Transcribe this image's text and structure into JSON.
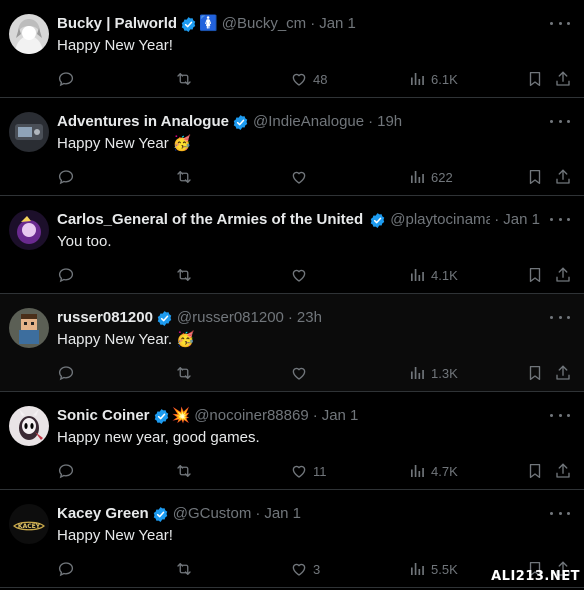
{
  "tweets": [
    {
      "name": "Bucky | Palworld",
      "verified": true,
      "badge_emoji": "🚺",
      "handle": "@Bucky_cm",
      "time": "Jan 1",
      "text": "Happy New Year!",
      "likes": "48",
      "views": "6.1K",
      "avatar": "white-haired-character-avatar"
    },
    {
      "name": "Adventures in Analogue",
      "verified": true,
      "handle": "@IndieAnalogue",
      "time": "19h",
      "text": "Happy New Year 🥳",
      "likes": "",
      "views": "622",
      "avatar": "dark-game-console-avatar"
    },
    {
      "name": "Carlos_General of the Armies of the United S",
      "verified": true,
      "handle": "@playtocinama",
      "time": "Jan 1",
      "text": "You too.",
      "likes": "",
      "views": "4.1K",
      "avatar": "purple-character-avatar"
    },
    {
      "name": "russer081200",
      "verified": true,
      "handle": "@russer081200",
      "time": "23h",
      "text": "Happy New Year. 🥳",
      "likes": "",
      "views": "1.3K",
      "avatar": "pixel-character-avatar"
    },
    {
      "name": "Sonic Coiner",
      "verified": true,
      "badge_emoji": "💥",
      "handle": "@nocoiner88869",
      "time": "Jan 1",
      "text": "Happy new year, good games.",
      "likes": "11",
      "views": "4.7K",
      "avatar": "masked-knight-avatar"
    },
    {
      "name": "Kacey Green",
      "verified": true,
      "handle": "@GCustom",
      "time": "Jan 1",
      "text": "Happy New Year!",
      "likes": "3",
      "views": "5.5K",
      "avatar": "kacey-logo-avatar"
    }
  ],
  "colors": {
    "background": "#000000",
    "text": "#e7e9ea",
    "muted": "#71767b",
    "verified": "#1d9bf0",
    "divider": "#2f3336"
  },
  "watermark": "ALI213.NET"
}
